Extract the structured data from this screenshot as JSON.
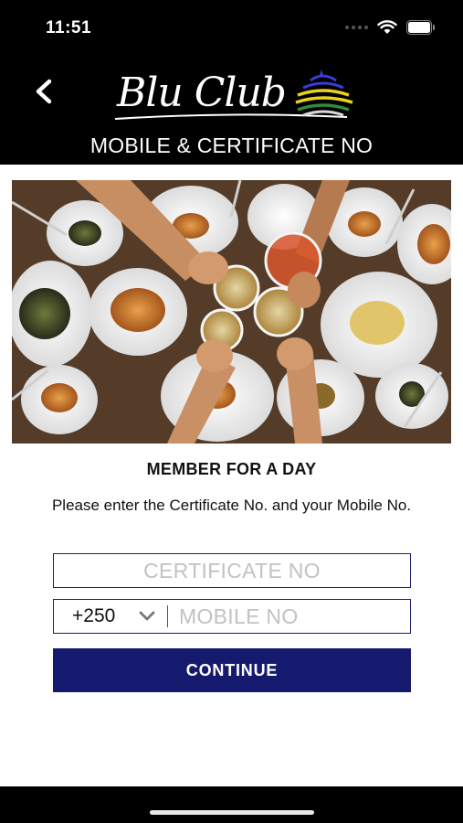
{
  "status_bar": {
    "time": "11:51"
  },
  "header": {
    "logo_text": "Blu Club",
    "title": "MOBILE & CERTIFICATE NO"
  },
  "hero": {
    "description_icon": "food-photo"
  },
  "main": {
    "section_title": "MEMBER FOR A DAY",
    "instructions": "Please enter the Certificate No. and your Mobile No.",
    "certificate_placeholder": "CERTIFICATE NO",
    "country_code": "+250",
    "mobile_placeholder": "MOBILE NO",
    "continue_label": "CONTINUE"
  },
  "colors": {
    "primary": "#161a6e",
    "field_border": "#1a1f6b",
    "header_bg": "#000000",
    "logo_stripe_colors": [
      "#3b3bd6",
      "#e8d21c",
      "#2e8b3e",
      "#e8e8e8"
    ]
  }
}
